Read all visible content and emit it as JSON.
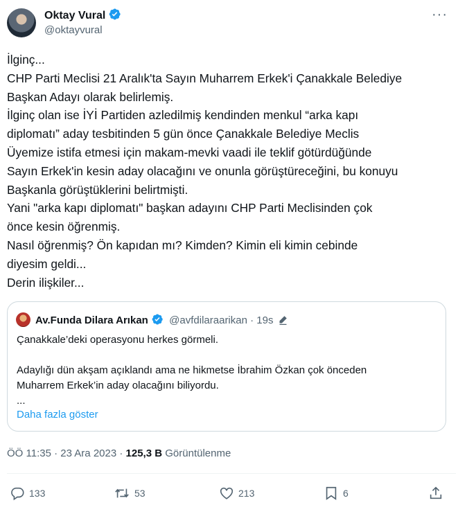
{
  "author": {
    "name": "Oktay Vural",
    "handle": "@oktayvural"
  },
  "more_label": "···",
  "tweet_lines": [
    "İlginç...",
    "CHP Parti Meclisi 21 Aralık'ta Sayın Muharrem Erkek'i Çanakkale Belediye",
    "Başkan Adayı olarak belirlemiş.",
    "İlginç olan ise İYİ Partiden azledilmiş kendinden menkul “arka kapı",
    "diplomatı” aday tesbitinden 5 gün önce Çanakkale Belediye Meclis",
    "Üyemize istifa etmesi için makam-mevki vaadi ile teklif götürdüğünde",
    "Sayın Erkek'in kesin aday olacağını ve onunla görüştüreceğini, bu konuyu",
    "Başkanla görüştüklerini belirtmişti.",
    "Yani \"arka kapı diplomatı\" başkan adayını CHP Parti Meclisinden çok",
    "önce kesin öğrenmiş.",
    "Nasıl öğrenmiş? Ön kapıdan mı? Kimden? Kimin eli kimin cebinde",
    "diyesim geldi...",
    "Derin ilişkiler..."
  ],
  "quote": {
    "name": "Av.Funda Dilara Arıkan",
    "handle": "@avfdilaraarikan",
    "time": "19s",
    "lines": [
      "Çanakkale’deki operasyonu herkes görmeli.",
      "",
      "Adaylığı dün akşam açıklandı ama ne hikmetse İbrahim Özkan çok önceden",
      "Muharrem Erkek’in aday olacağını biliyordu.",
      "..."
    ],
    "show_more": "Daha fazla göster"
  },
  "meta": {
    "time": "ÖÖ 11:35",
    "date": "23 Ara 2023",
    "views": "125,3 B",
    "views_label": "Görüntülenme"
  },
  "actions": {
    "replies": "133",
    "retweets": "53",
    "likes": "213",
    "bookmarks": "6"
  },
  "colors": {
    "verified": "#1d9bf0",
    "link": "#1d9bf0",
    "secondary_text": "#536471"
  }
}
